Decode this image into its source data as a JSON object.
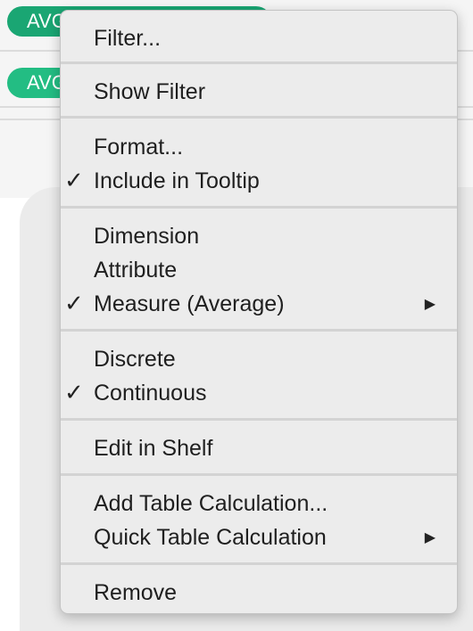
{
  "background": {
    "pill1": "AVG",
    "pill2": "AVG"
  },
  "menu": {
    "items": [
      {
        "label": "Filter...",
        "checked": false,
        "submenu": false
      },
      {
        "label": "Show Filter",
        "checked": false,
        "submenu": false
      },
      {
        "label": "Format...",
        "checked": false,
        "submenu": false
      },
      {
        "label": "Include in Tooltip",
        "checked": true,
        "submenu": false
      },
      {
        "label": "Dimension",
        "checked": false,
        "submenu": false
      },
      {
        "label": "Attribute",
        "checked": false,
        "submenu": false
      },
      {
        "label": "Measure (Average)",
        "checked": true,
        "submenu": true
      },
      {
        "label": "Discrete",
        "checked": false,
        "submenu": false
      },
      {
        "label": "Continuous",
        "checked": true,
        "submenu": false
      },
      {
        "label": "Edit in Shelf",
        "checked": false,
        "submenu": false
      },
      {
        "label": "Add Table Calculation...",
        "checked": false,
        "submenu": false
      },
      {
        "label": "Quick Table Calculation",
        "checked": false,
        "submenu": true
      },
      {
        "label": "Remove",
        "checked": false,
        "submenu": false
      }
    ],
    "check_glyph": "✓",
    "submenu_glyph": "▶"
  },
  "colors": {
    "pill_dark": "#1aa673",
    "pill_light": "#23bd83",
    "menu_bg": "#ececec"
  }
}
